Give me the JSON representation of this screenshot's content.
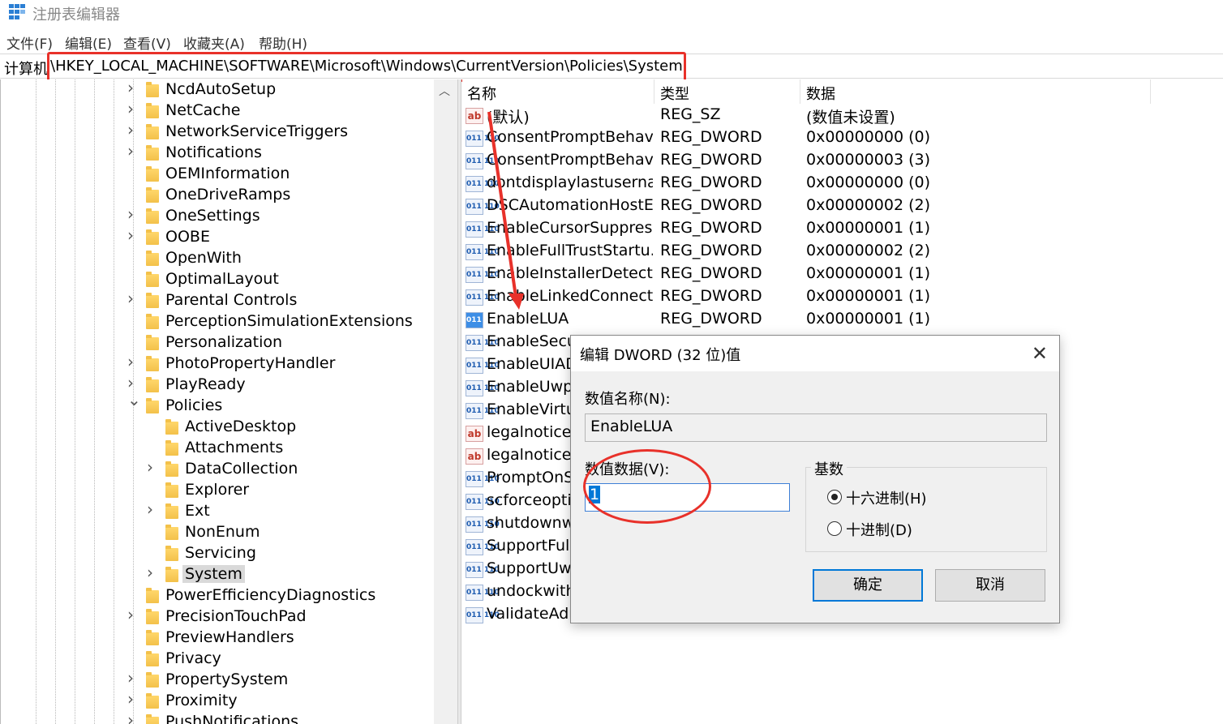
{
  "window": {
    "title": "注册表编辑器",
    "app_icon": "regedit-icon"
  },
  "menu": [
    "文件(F)",
    "编辑(E)",
    "查看(V)",
    "收藏夹(A)",
    "帮助(H)"
  ],
  "address": {
    "root": "计算机",
    "path": "\\HKEY_LOCAL_MACHINE\\SOFTWARE\\Microsoft\\Windows\\CurrentVersion\\Policies\\System"
  },
  "tree": {
    "items": [
      {
        "label": "NcdAutoSetup",
        "expander": "collapsed"
      },
      {
        "label": "NetCache",
        "expander": "collapsed"
      },
      {
        "label": "NetworkServiceTriggers",
        "expander": "collapsed"
      },
      {
        "label": "Notifications",
        "expander": "collapsed"
      },
      {
        "label": "OEMInformation",
        "expander": "none"
      },
      {
        "label": "OneDriveRamps",
        "expander": "none"
      },
      {
        "label": "OneSettings",
        "expander": "collapsed"
      },
      {
        "label": "OOBE",
        "expander": "collapsed"
      },
      {
        "label": "OpenWith",
        "expander": "none"
      },
      {
        "label": "OptimalLayout",
        "expander": "none"
      },
      {
        "label": "Parental Controls",
        "expander": "collapsed"
      },
      {
        "label": "PerceptionSimulationExtensions",
        "expander": "none"
      },
      {
        "label": "Personalization",
        "expander": "none"
      },
      {
        "label": "PhotoPropertyHandler",
        "expander": "collapsed"
      },
      {
        "label": "PlayReady",
        "expander": "collapsed"
      },
      {
        "label": "Policies",
        "expander": "expanded"
      },
      {
        "label": "ActiveDesktop",
        "expander": "none",
        "child": true
      },
      {
        "label": "Attachments",
        "expander": "none",
        "child": true
      },
      {
        "label": "DataCollection",
        "expander": "collapsed",
        "child": true
      },
      {
        "label": "Explorer",
        "expander": "none",
        "child": true
      },
      {
        "label": "Ext",
        "expander": "collapsed",
        "child": true
      },
      {
        "label": "NonEnum",
        "expander": "none",
        "child": true
      },
      {
        "label": "Servicing",
        "expander": "none",
        "child": true
      },
      {
        "label": "System",
        "expander": "collapsed",
        "child": true,
        "selected": true
      },
      {
        "label": "PowerEfficiencyDiagnostics",
        "expander": "none"
      },
      {
        "label": "PrecisionTouchPad",
        "expander": "collapsed"
      },
      {
        "label": "PreviewHandlers",
        "expander": "none"
      },
      {
        "label": "Privacy",
        "expander": "none"
      },
      {
        "label": "PropertySystem",
        "expander": "collapsed"
      },
      {
        "label": "Proximity",
        "expander": "collapsed"
      },
      {
        "label": "PushNotifications",
        "expander": "collapsed"
      }
    ]
  },
  "values": {
    "headers": {
      "name": "名称",
      "type": "类型",
      "data": "数据"
    },
    "rows": [
      {
        "name": "(默认)",
        "type": "REG_SZ",
        "data": "(数值未设置)",
        "icon": "string-value-icon"
      },
      {
        "name": "ConsentPromptBehavi...",
        "type": "REG_DWORD",
        "data": "0x00000000 (0)",
        "icon": "dword-value-icon"
      },
      {
        "name": "ConsentPromptBehavi...",
        "type": "REG_DWORD",
        "data": "0x00000003 (3)",
        "icon": "dword-value-icon"
      },
      {
        "name": "dontdisplaylastusername...",
        "type": "REG_DWORD",
        "data": "0x00000000 (0)",
        "icon": "dword-value-icon"
      },
      {
        "name": "DSCAutomationHostE...",
        "type": "REG_DWORD",
        "data": "0x00000002 (2)",
        "icon": "dword-value-icon"
      },
      {
        "name": "EnableCursorSuppress...",
        "type": "REG_DWORD",
        "data": "0x00000001 (1)",
        "icon": "dword-value-icon"
      },
      {
        "name": "EnableFullTrustStartu...",
        "type": "REG_DWORD",
        "data": "0x00000002 (2)",
        "icon": "dword-value-icon"
      },
      {
        "name": "EnableInstallerDetecti...",
        "type": "REG_DWORD",
        "data": "0x00000001 (1)",
        "icon": "dword-value-icon"
      },
      {
        "name": "EnableLinkedConnecti...",
        "type": "REG_DWORD",
        "data": "0x00000001 (1)",
        "icon": "dword-value-icon"
      },
      {
        "name": "EnableLUA",
        "type": "REG_DWORD",
        "data": "0x00000001 (1)",
        "icon": "dword-value-icon",
        "selected": true
      },
      {
        "name": "EnableSecur",
        "type": "",
        "data": "",
        "icon": "dword-value-icon"
      },
      {
        "name": "EnableUIAD",
        "type": "",
        "data": "",
        "icon": "dword-value-icon"
      },
      {
        "name": "EnableUwpS",
        "type": "",
        "data": "",
        "icon": "dword-value-icon"
      },
      {
        "name": "EnableVirtua",
        "type": "",
        "data": "",
        "icon": "dword-value-icon"
      },
      {
        "name": "legalnoticec",
        "type": "",
        "data": "",
        "icon": "string-value-icon"
      },
      {
        "name": "legalnoticet",
        "type": "",
        "data": "",
        "icon": "string-value-icon"
      },
      {
        "name": "PromptOnSe",
        "type": "",
        "data": "",
        "icon": "dword-value-icon"
      },
      {
        "name": "scforceoptio",
        "type": "",
        "data": "",
        "icon": "dword-value-icon"
      },
      {
        "name": "shutdownwi",
        "type": "",
        "data": "",
        "icon": "dword-value-icon"
      },
      {
        "name": "SupportFullT",
        "type": "",
        "data": "",
        "icon": "dword-value-icon"
      },
      {
        "name": "SupportUwp",
        "type": "",
        "data": "",
        "icon": "dword-value-icon"
      },
      {
        "name": "undockwitho",
        "type": "",
        "data": "",
        "icon": "dword-value-icon"
      },
      {
        "name": "ValidateAdn",
        "type": "",
        "data": "",
        "icon": "dword-value-icon"
      }
    ]
  },
  "dialog": {
    "title": "编辑 DWORD (32 位)值",
    "name_label": "数值名称(N):",
    "name_value": "EnableLUA",
    "data_label": "数值数据(V):",
    "data_value": "1",
    "base_label": "基数",
    "hex_label": "十六进制(H)",
    "dec_label": "十进制(D)",
    "base_selected": "hex",
    "ok_label": "确定",
    "cancel_label": "取消"
  },
  "colors": {
    "annotation": "#e8312a",
    "focus": "#0078d7"
  }
}
